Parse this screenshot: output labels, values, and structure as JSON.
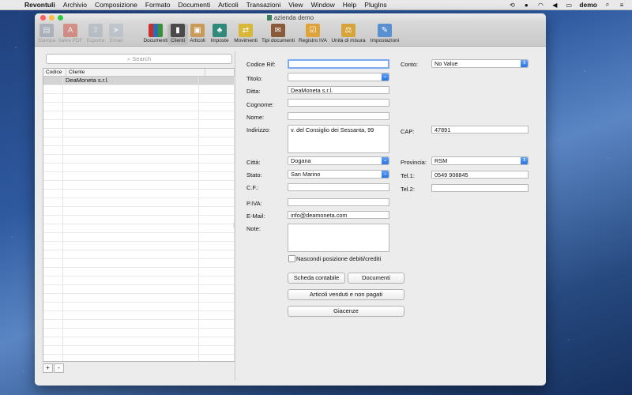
{
  "menubar": {
    "app": "Revontuli",
    "items": [
      "Archivio",
      "Composizione",
      "Formato",
      "Documenti",
      "Articoli",
      "Transazioni",
      "View",
      "Window",
      "Help",
      "PlugIns"
    ],
    "user": "demo"
  },
  "window": {
    "title": "azienda demo"
  },
  "toolbar": {
    "items": [
      {
        "label": "Stampa"
      },
      {
        "label": "Salva PDF"
      },
      {
        "label": "Esporta"
      },
      {
        "label": "Email"
      },
      {
        "label": "Documenti"
      },
      {
        "label": "Clienti"
      },
      {
        "label": "Articoli"
      },
      {
        "label": "Imposte"
      },
      {
        "label": "Movimenti"
      },
      {
        "label": "Tipi documenti"
      },
      {
        "label": "Registro IVA"
      },
      {
        "label": "Unità di misura"
      },
      {
        "label": "Impostazioni"
      }
    ]
  },
  "list": {
    "search_placeholder": "Search",
    "columns": [
      "Codice",
      "Cliente"
    ],
    "rows": [
      {
        "codice": "",
        "cliente": "DeaMoneta s.r.l."
      }
    ],
    "add_label": "+",
    "remove_label": "-"
  },
  "form": {
    "codice_rif": {
      "label": "Codice Rif:",
      "value": ""
    },
    "titolo": {
      "label": "Titolo:",
      "value": ""
    },
    "ditta": {
      "label": "Ditta:",
      "value": "DeaMoneta s.r.l."
    },
    "cognome": {
      "label": "Cognome:",
      "value": ""
    },
    "nome": {
      "label": "Nome:",
      "value": ""
    },
    "indirizzo": {
      "label": "Indirizzo:",
      "value": "v. del Consiglio dei Sessanta, 99"
    },
    "citta": {
      "label": "Città:",
      "value": "Dogana"
    },
    "stato": {
      "label": "Stato:",
      "value": "San Marino"
    },
    "cf": {
      "label": "C.F.:",
      "value": ""
    },
    "piva": {
      "label": "P.IVA:",
      "value": ""
    },
    "email": {
      "label": "E-Mail:",
      "value": "info@deamoneta.com"
    },
    "note": {
      "label": "Note:",
      "value": ""
    },
    "conto": {
      "label": "Conto:",
      "value": "No Value"
    },
    "cap": {
      "label": "CAP:",
      "value": "47891"
    },
    "provincia": {
      "label": "Provincia:",
      "value": "RSM"
    },
    "tel1": {
      "label": "Tel.1:",
      "value": "0549 908845"
    },
    "tel2": {
      "label": "Tel.2:",
      "value": ""
    },
    "nascondi": {
      "label": "Nascondi posizione debiti/crediti",
      "checked": false
    },
    "buttons": {
      "scheda": "Scheda contabile",
      "documenti": "Documenti",
      "articoli": "Articoli venduti e non pagati",
      "giacenze": "Giacenze"
    }
  }
}
